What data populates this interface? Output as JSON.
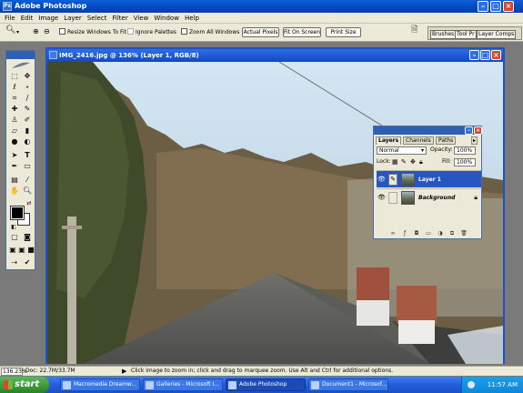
{
  "app": {
    "title": "Adobe Photoshop"
  },
  "menu": [
    "File",
    "Edit",
    "Image",
    "Layer",
    "Select",
    "Filter",
    "View",
    "Window",
    "Help"
  ],
  "options": {
    "resize_windows": "Resize Windows To Fit",
    "ignore_palettes": "Ignore Palettes",
    "zoom_all_windows": "Zoom All Windows",
    "actual_pixels": "Actual Pixels",
    "fit_on_screen": "Fit On Screen",
    "print_size": "Print Size"
  },
  "palette_well": [
    "Brushes",
    "Tool Pr",
    "Layer Comps"
  ],
  "document": {
    "title": "IMG_2416.jpg @ 136% (Layer 1, RGB/8)"
  },
  "layers_palette": {
    "tabs": [
      "Layers",
      "Channels",
      "Paths"
    ],
    "blend_mode": "Normal",
    "opacity_label": "Opacity:",
    "opacity_value": "100%",
    "lock_label": "Lock:",
    "fill_label": "Fill:",
    "fill_value": "100%",
    "layers": [
      {
        "name": "Layer 1",
        "active": true
      },
      {
        "name": "Background",
        "active": false,
        "locked": true
      }
    ]
  },
  "status": {
    "zoom": "136.23%",
    "doc": "Doc: 22.7M/33.7M",
    "hint": "Click image to zoom in; click and drag to marquee zoom.  Use Alt and Ctrl for additional options."
  },
  "taskbar": {
    "start": "start",
    "tasks": [
      {
        "label": "Macromedia Dreamw...",
        "active": false
      },
      {
        "label": "Galleries - Microsoft I...",
        "active": false
      },
      {
        "label": "Adobe Photoshop",
        "active": true
      },
      {
        "label": "Document1 - Microsof...",
        "active": false
      }
    ],
    "clock": "11:57 AM"
  },
  "colors": {
    "foreground": "#000000",
    "background": "#ffffff",
    "titlebar": "#0a4fc8",
    "selected_layer": "#2856c0"
  }
}
